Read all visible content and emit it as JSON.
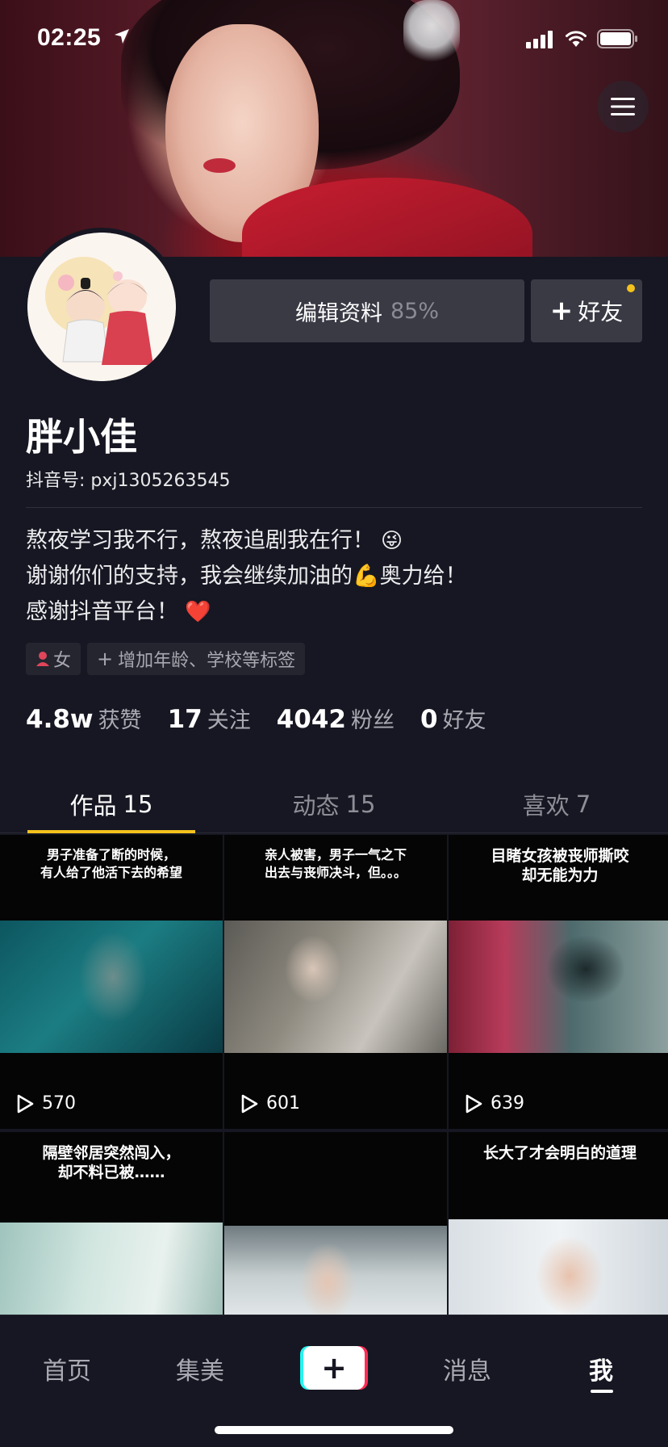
{
  "status_bar": {
    "time": "02:25"
  },
  "profile": {
    "edit_label": "编辑资料",
    "edit_percent": "85%",
    "friend_label": "好友",
    "nickname": "胖小佳",
    "douyin_id": "抖音号: pxj1305263545",
    "bio": [
      {
        "text": "熬夜学习我不行，熬夜追剧我在行！",
        "emoji": "😜"
      },
      {
        "text": "谢谢你们的支持，我会继续加油的💪奥力给！",
        "emoji": ""
      },
      {
        "text": "感谢抖音平台！",
        "emoji": "❤️"
      }
    ],
    "tags": {
      "gender": "女",
      "add_tags": "增加年龄、学校等标签"
    },
    "stats": [
      {
        "num": "4.8w",
        "label": "获赞"
      },
      {
        "num": "17",
        "label": "关注"
      },
      {
        "num": "4042",
        "label": "粉丝"
      },
      {
        "num": "0",
        "label": "好友"
      }
    ]
  },
  "tabs": [
    {
      "label": "作品",
      "count": "15"
    },
    {
      "label": "动态",
      "count": "15"
    },
    {
      "label": "喜欢",
      "count": "7"
    }
  ],
  "videos": [
    {
      "caption": "男子准备了断的时候，\n有人给了他活下去的希望",
      "plays": "570"
    },
    {
      "caption": "亲人被害，男子一气之下\n出去与丧师决斗，但。。。",
      "plays": "601"
    },
    {
      "caption": "目睹女孩被丧师撕咬\n却无能为力",
      "plays": "639"
    },
    {
      "caption": "隔壁邻居突然闯入，\n却不料已被……",
      "plays": ""
    },
    {
      "caption": "",
      "plays": ""
    },
    {
      "caption": "长大了才会明白的道理",
      "plays": ""
    }
  ],
  "bottom_nav": {
    "home": "首页",
    "jimei": "集美",
    "add": "+",
    "messages": "消息",
    "me": "我"
  },
  "colors": {
    "background": "#161722",
    "button_bg": "#393a44",
    "accent_yellow": "#f4c21c",
    "tiktok_cyan": "#25f4ee",
    "tiktok_red": "#fe2c55",
    "muted_text": "#a9aab2"
  }
}
